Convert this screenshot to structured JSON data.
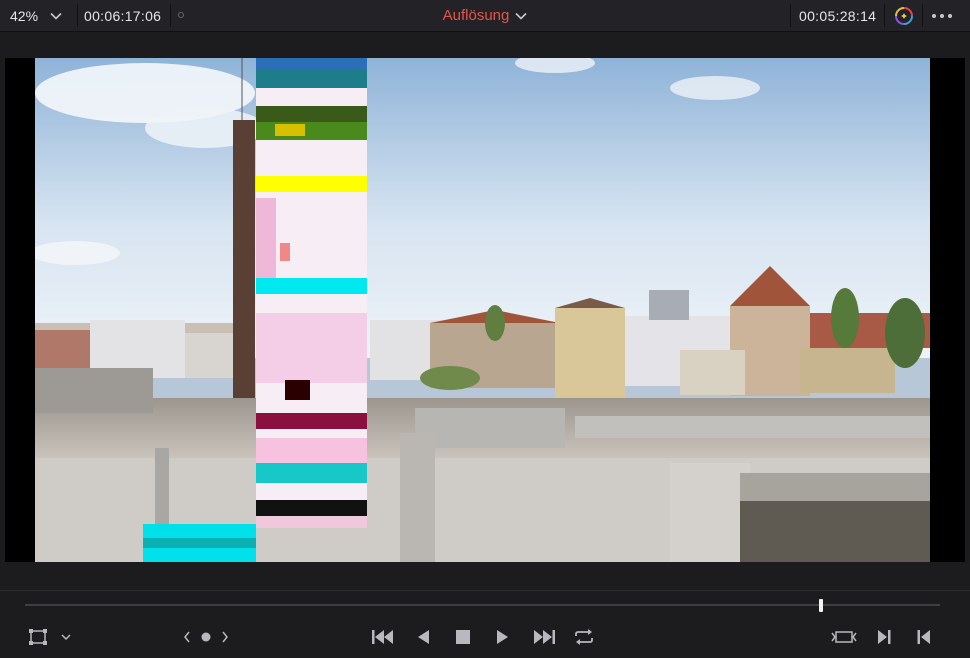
{
  "header": {
    "zoom": "42%",
    "timecode_left": "00:06:17:06",
    "title": "Auflösung",
    "timecode_right": "00:05:28:14"
  },
  "colors": {
    "title": "#e5544a",
    "background": "#1c1c1f",
    "toolbar": "#232327",
    "icon": "#b8b8be"
  },
  "icons": {
    "zoom_dropdown": "chevron-down-icon",
    "title_dropdown": "chevron-down-icon",
    "effects": "color-effects-icon",
    "more": "more-options-icon",
    "transform": "transform-icon",
    "nav": "prev-next-edit-icon",
    "first_frame": "skip-to-start-icon",
    "reverse": "play-reverse-icon",
    "stop": "stop-icon",
    "play": "play-icon",
    "last_frame": "skip-to-end-icon",
    "loop": "loop-icon",
    "match_frame": "match-frame-icon",
    "next_clip": "next-clip-icon",
    "prev_clip": "prev-clip-icon"
  },
  "scrubber": {
    "position": 0.87
  }
}
